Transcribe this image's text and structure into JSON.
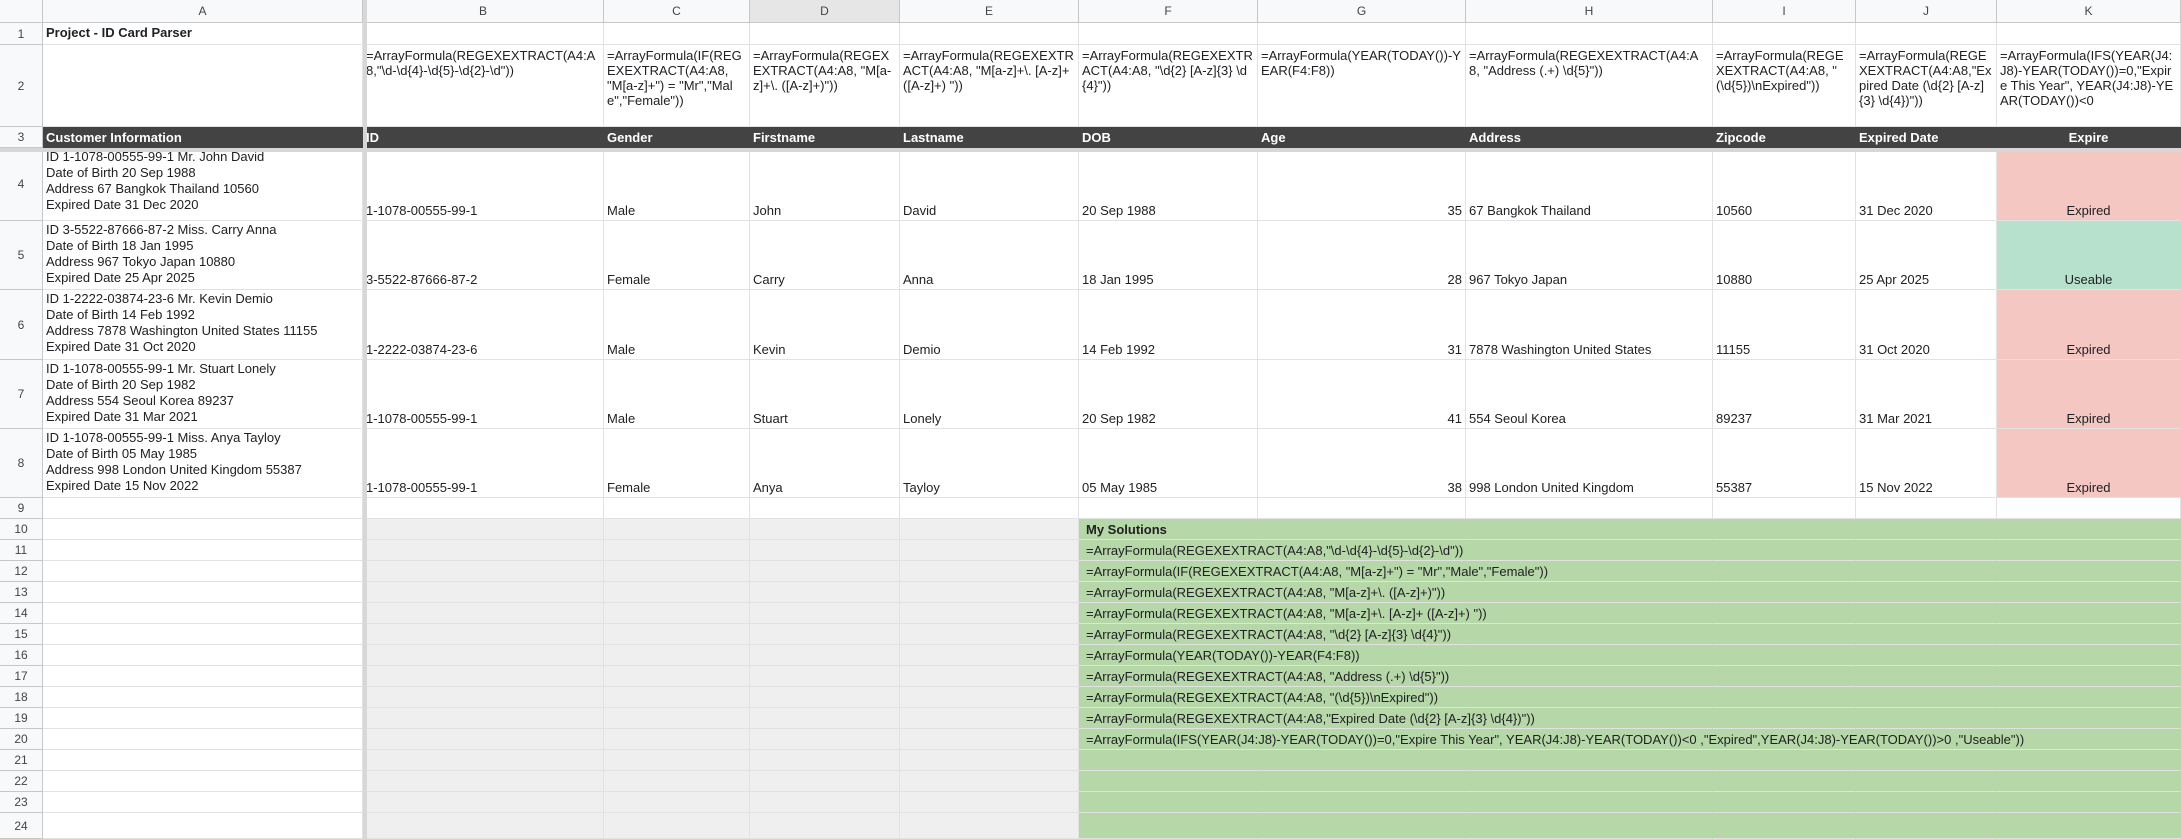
{
  "columns": [
    "A",
    "B",
    "C",
    "D",
    "E",
    "F",
    "G",
    "H",
    "I",
    "J",
    "K"
  ],
  "rows": [
    "1",
    "2",
    "3",
    "4",
    "5",
    "6",
    "7",
    "8",
    "9",
    "10",
    "11",
    "12",
    "13",
    "14",
    "15",
    "16",
    "17",
    "18",
    "19",
    "20",
    "21",
    "22",
    "23",
    "24"
  ],
  "title": "Project - ID Card Parser",
  "formulas": {
    "B": "=ArrayFormula(REGEXEXTRACT(A4:A8,\"\\d-\\d{4}-\\d{5}-\\d{2}-\\d\"))",
    "C": "=ArrayFormula(IF(REGEXEXTRACT(A4:A8, \"M[a-z]+\") = \"Mr\",\"Male\",\"Female\"))",
    "D": "=ArrayFormula(REGEXEXTRACT(A4:A8, \"M[a-z]+\\. ([A-z]+)\"))",
    "E": "=ArrayFormula(REGEXEXTRACT(A4:A8, \"M[a-z]+\\. [A-z]+ ([A-z]+) \"))",
    "F": "=ArrayFormula(REGEXEXTRACT(A4:A8, \"\\d{2} [A-z]{3} \\d{4}\"))",
    "G": "=ArrayFormula(YEAR(TODAY())-YEAR(F4:F8))",
    "H": "=ArrayFormula(REGEXEXTRACT(A4:A8, \"Address (.+) \\d{5}\"))",
    "I": "=ArrayFormula(REGEXEXTRACT(A4:A8, \"(\\d{5})\\nExpired\"))",
    "J": "=ArrayFormula(REGEXEXTRACT(A4:A8,\"Expired Date (\\d{2} [A-z]{3} \\d{4})\"))",
    "K": "=ArrayFormula(IFS(YEAR(J4:J8)-YEAR(TODAY())=0,\"Expire This Year\", YEAR(J4:J8)-YEAR(TODAY())<0"
  },
  "headers": [
    "Customer Information",
    "ID",
    "Gender",
    "Firstname",
    "Lastname",
    "DOB",
    "Age",
    "Address",
    "Zipcode",
    "Expired Date",
    "Expire"
  ],
  "records": [
    {
      "info": [
        "ID 1-1078-00555-99-1 Mr. John David",
        "Date of Birth 20 Sep 1988",
        "Address 67 Bangkok Thailand 10560",
        "Expired Date 31 Dec 2020"
      ],
      "id": "1-1078-00555-99-1",
      "gender": "Male",
      "first": "John",
      "last": "David",
      "dob": "20 Sep 1988",
      "age": "35",
      "address": "67 Bangkok Thailand",
      "zip": "10560",
      "expdate": "31 Dec 2020",
      "expire": "Expired",
      "status_color": "#f4c7c3"
    },
    {
      "info": [
        "ID 3-5522-87666-87-2 Miss. Carry Anna",
        "Date of Birth 18 Jan 1995",
        "Address 967 Tokyo Japan 10880",
        "Expired Date 25 Apr 2025"
      ],
      "id": "3-5522-87666-87-2",
      "gender": "Female",
      "first": "Carry",
      "last": "Anna",
      "dob": "18 Jan 1995",
      "age": "28",
      "address": "967 Tokyo Japan",
      "zip": "10880",
      "expdate": "25 Apr 2025",
      "expire": "Useable",
      "status_color": "#b7e1cd"
    },
    {
      "info": [
        "ID 1-2222-03874-23-6 Mr. Kevin Demio",
        "Date of Birth 14 Feb 1992",
        "Address 7878 Washington United States 11155",
        "Expired Date 31 Oct 2020"
      ],
      "id": "1-2222-03874-23-6",
      "gender": "Male",
      "first": "Kevin",
      "last": "Demio",
      "dob": "14 Feb 1992",
      "age": "31",
      "address": "7878 Washington United States",
      "zip": "11155",
      "expdate": "31 Oct 2020",
      "expire": "Expired",
      "status_color": "#f4c7c3"
    },
    {
      "info": [
        "ID 1-1078-00555-99-1 Mr. Stuart Lonely",
        "Date of Birth 20 Sep 1982",
        "Address 554 Seoul Korea 89237",
        "Expired Date 31 Mar 2021"
      ],
      "id": "1-1078-00555-99-1",
      "gender": "Male",
      "first": "Stuart",
      "last": "Lonely",
      "dob": "20 Sep 1982",
      "age": "41",
      "address": "554 Seoul Korea",
      "zip": "89237",
      "expdate": "31 Mar 2021",
      "expire": "Expired",
      "status_color": "#f4c7c3"
    },
    {
      "info": [
        "ID 1-1078-00555-99-1 Miss. Anya Tayloy",
        "Date of Birth 05 May 1985",
        "Address 998 London United Kingdom 55387",
        "Expired Date 15 Nov 2022"
      ],
      "id": "1-1078-00555-99-1",
      "gender": "Female",
      "first": "Anya",
      "last": "Tayloy",
      "dob": "05 May 1985",
      "age": "38",
      "address": "998 London United Kingdom",
      "zip": "55387",
      "expdate": "15 Nov 2022",
      "expire": "Expired",
      "status_color": "#f4c7c3"
    }
  ],
  "solutions": {
    "title": "My Solutions",
    "lines": [
      "=ArrayFormula(REGEXEXTRACT(A4:A8,\"\\d-\\d{4}-\\d{5}-\\d{2}-\\d\"))",
      "=ArrayFormula(IF(REGEXEXTRACT(A4:A8, \"M[a-z]+\") = \"Mr\",\"Male\",\"Female\"))",
      "=ArrayFormula(REGEXEXTRACT(A4:A8, \"M[a-z]+\\. ([A-z]+)\"))",
      "=ArrayFormula(REGEXEXTRACT(A4:A8, \"M[a-z]+\\. [A-z]+ ([A-z]+) \"))",
      "=ArrayFormula(REGEXEXTRACT(A4:A8, \"\\d{2} [A-z]{3} \\d{4}\"))",
      "=ArrayFormula(YEAR(TODAY())-YEAR(F4:F8))",
      "=ArrayFormula(REGEXEXTRACT(A4:A8, \"Address (.+) \\d{5}\"))",
      "=ArrayFormula(REGEXEXTRACT(A4:A8, \"(\\d{5})\\nExpired\"))",
      "=ArrayFormula(REGEXEXTRACT(A4:A8,\"Expired Date (\\d{2} [A-z]{3} \\d{4})\"))",
      "=ArrayFormula(IFS(YEAR(J4:J8)-YEAR(TODAY())=0,\"Expire This Year\", YEAR(J4:J8)-YEAR(TODAY())<0  ,\"Expired\",YEAR(J4:J8)-YEAR(TODAY())>0 ,\"Useable\"))"
    ]
  },
  "colors": {
    "header_bg": "#434343",
    "expired": "#f4c7c3",
    "useable": "#b7e1cd",
    "solution_bg": "#b6d7a8",
    "gray_area": "#efefef"
  }
}
